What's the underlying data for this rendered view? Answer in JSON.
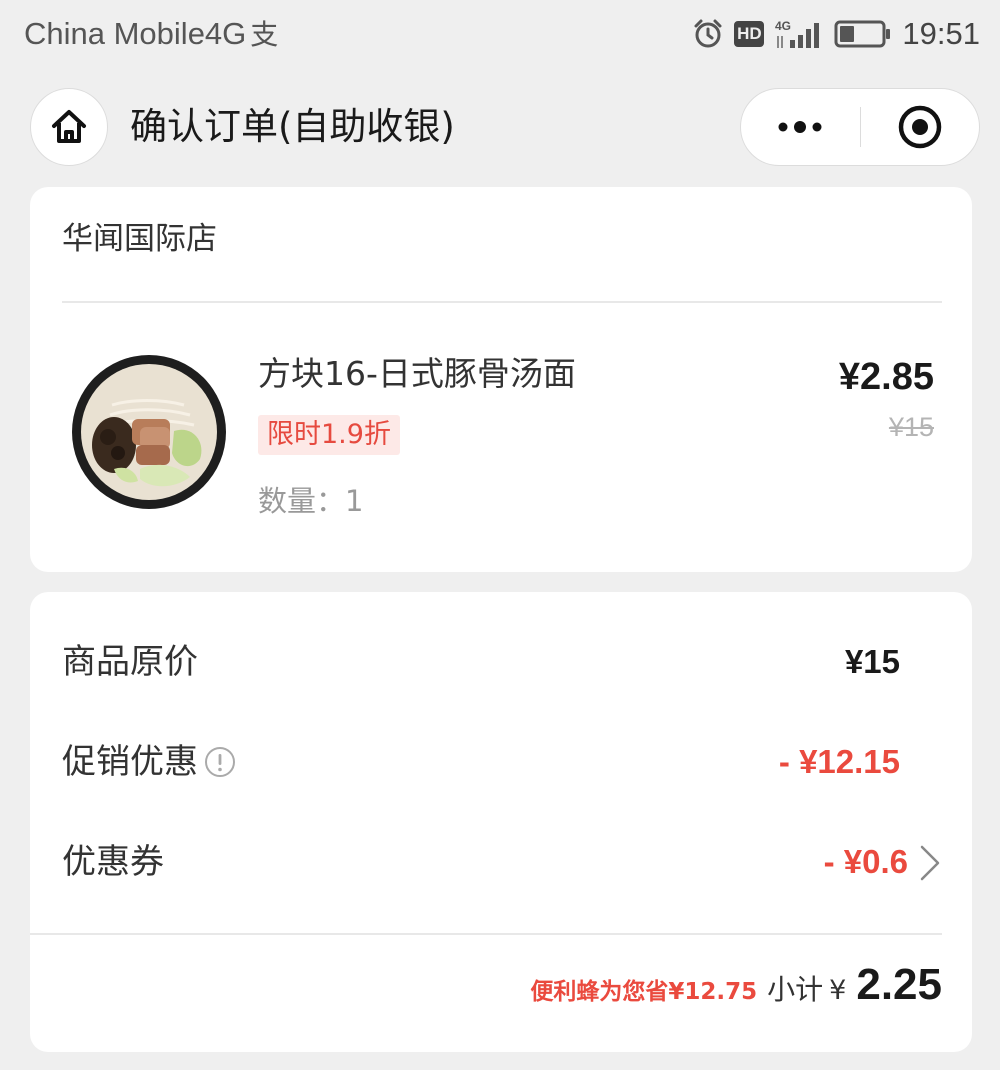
{
  "status_bar": {
    "carrier": "China Mobile4G",
    "network_badge": "HD",
    "signal_label": "4G",
    "time": "19:51"
  },
  "header": {
    "title": "确认订单(自助收银)"
  },
  "order": {
    "store_name": "华闻国际店",
    "product": {
      "name": "方块16-日式豚骨汤面",
      "discount_tag": "限时1.9折",
      "quantity_text": "数量：1",
      "price": "¥2.85",
      "original_price": "¥15"
    }
  },
  "summary": {
    "original_label": "商品原价",
    "original_value": "¥15",
    "promotion_label": "促销优惠",
    "promotion_value": "- ¥12.15",
    "coupon_label": "优惠券",
    "coupon_value": "- ¥0.6",
    "saved_text": "便利蜂为您省¥12.75",
    "subtotal_label": "小计",
    "subtotal_currency": "¥",
    "subtotal_amount": "2.25"
  },
  "colors": {
    "accent_red": "#ea4a3e",
    "tag_background": "#fde9e7",
    "page_background": "#efefef"
  }
}
